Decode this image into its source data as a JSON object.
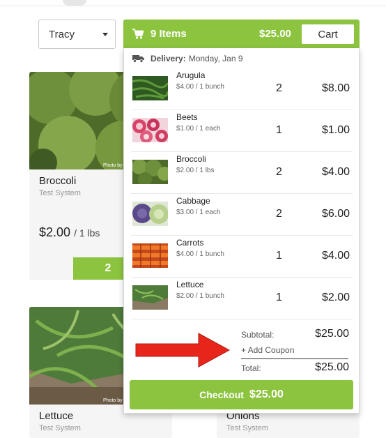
{
  "user_select": {
    "value": "Tracy"
  },
  "cart": {
    "item_count_label": "9 Items",
    "header_total": "$25.00",
    "cart_button_label": "Cart",
    "delivery_label": "Delivery:",
    "delivery_date": "Monday, Jan 9",
    "items": [
      {
        "name": "Arugula",
        "price": "$4.00 / 1 bunch",
        "qty": "2",
        "total": "$8.00"
      },
      {
        "name": "Beets",
        "price": "$1.00 / 1 each",
        "qty": "1",
        "total": "$1.00"
      },
      {
        "name": "Broccoli",
        "price": "$2.00 / 1 lbs",
        "qty": "2",
        "total": "$4.00"
      },
      {
        "name": "Cabbage",
        "price": "$3.00 / 1 each",
        "qty": "2",
        "total": "$6.00"
      },
      {
        "name": "Carrots",
        "price": "$4.00 / 1 bunch",
        "qty": "1",
        "total": "$4.00"
      },
      {
        "name": "Lettuce",
        "price": "$2.00 / 1 bunch",
        "qty": "1",
        "total": "$2.00"
      }
    ],
    "subtotal_label": "Subtotal:",
    "subtotal_value": "$25.00",
    "coupon_label": "+ Add Coupon",
    "total_label": "Total:",
    "total_value": "$25.00",
    "checkout_label": "Checkout",
    "checkout_amount": "$25.00"
  },
  "products": [
    {
      "name": "Broccoli",
      "system": "Test System",
      "price": "$2.00",
      "unit": "/ 1 lbs",
      "qty": "2",
      "photo_credit": "Photo by"
    },
    {
      "name": "Lettuce",
      "system": "Test System",
      "photo_credit": "Photo by"
    },
    {
      "name": "Onions",
      "system": "Test System"
    }
  ],
  "colors": {
    "accent": "#8cc43f",
    "arrow": "#e8251b"
  }
}
